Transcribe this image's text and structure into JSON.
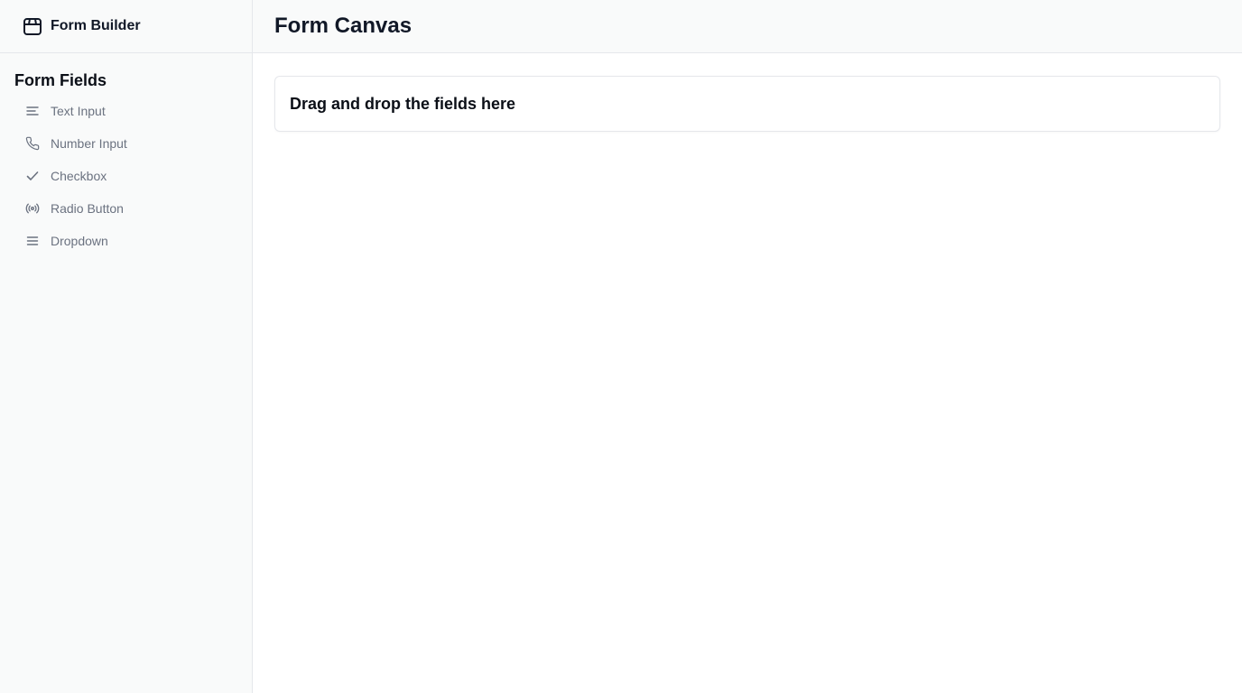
{
  "app": {
    "title": "Form Builder",
    "icon": "package-icon"
  },
  "sidebar": {
    "heading": "Form Fields",
    "items": [
      {
        "label": "Text Input",
        "icon": "text-align-icon"
      },
      {
        "label": "Number Input",
        "icon": "phone-icon"
      },
      {
        "label": "Checkbox",
        "icon": "check-icon"
      },
      {
        "label": "Radio Button",
        "icon": "radio-icon"
      },
      {
        "label": "Dropdown",
        "icon": "menu-icon"
      }
    ]
  },
  "main": {
    "title": "Form Canvas",
    "drop_zone_text": "Drag and drop the fields here"
  },
  "colors": {
    "sidebar_bg": "#f9fafa",
    "border": "#e5e7eb",
    "muted_text": "#6b7280",
    "heading_text": "#111827"
  }
}
